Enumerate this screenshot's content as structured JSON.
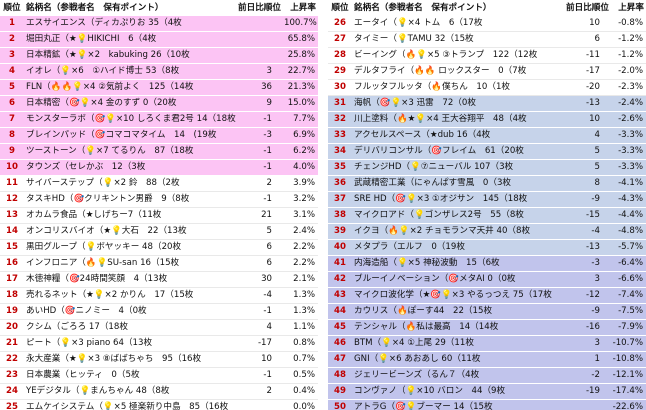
{
  "headers": {
    "rank": "順位",
    "name": "銘柄名（参戦者名　保有ポイント）",
    "change": "前日比順位",
    "rate": "上昇率"
  },
  "left_rows": [
    {
      "rank": "1",
      "name": "エスサイエンス（ディカぷりお 35（4枚",
      "change": "",
      "rate": "100.7%",
      "band": "pink"
    },
    {
      "rank": "2",
      "name": "堀田丸正（★💡HIKICHI　6（4枚",
      "change": "",
      "rate": "65.8%",
      "band": "pink"
    },
    {
      "rank": "3",
      "name": "日本精鉱（★💡×2　kabuking 26（10枚",
      "change": "",
      "rate": "25.8%",
      "band": "pink"
    },
    {
      "rank": "4",
      "name": "イオレ（💡×6　①ハイド博士 53（8枚",
      "change": "3",
      "rate": "22.7%",
      "band": "pink"
    },
    {
      "rank": "5",
      "name": "FLN（🔥🔥💡×4 ②気前よく　125（14枚",
      "change": "36",
      "rate": "21.3%",
      "band": "pink"
    },
    {
      "rank": "6",
      "name": "日本精密（🎯💡×4 金のすず 0（20枚",
      "change": "9",
      "rate": "15.0%",
      "band": "pink"
    },
    {
      "rank": "7",
      "name": "モンスターラボ（🎯💡×10 しろくま君2号 14（18枚",
      "change": "-1",
      "rate": "7.7%",
      "band": "pink"
    },
    {
      "rank": "8",
      "name": "ブレインパッド（🎯コマコマタイム　14　(19枚",
      "change": "-3",
      "rate": "6.9%",
      "band": "pink"
    },
    {
      "rank": "9",
      "name": "ツーストーン（💡×7 てるりん　87（18枚",
      "change": "-1",
      "rate": "6.2%",
      "band": "pink"
    },
    {
      "rank": "10",
      "name": "タウンズ（セレかぶ　12（3枚",
      "change": "-1",
      "rate": "4.0%",
      "band": "pink"
    },
    {
      "rank": "11",
      "name": "サイバーステップ（💡×2 鈴　88（2枚",
      "change": "2",
      "rate": "3.9%",
      "band": "white"
    },
    {
      "rank": "12",
      "name": "タスキHD（🎯クリキントン男爵　9（8枚",
      "change": "-1",
      "rate": "3.2%",
      "band": "white"
    },
    {
      "rank": "13",
      "name": "オカムラ食品（★しげちー7（11枚",
      "change": "21",
      "rate": "3.1%",
      "band": "white"
    },
    {
      "rank": "14",
      "name": "オンコリスバイオ（★💡大石　22（13枚",
      "change": "5",
      "rate": "2.4%",
      "band": "white"
    },
    {
      "rank": "15",
      "name": "黒田グループ（💡ボヤッキー 48（20枚",
      "change": "6",
      "rate": "2.2%",
      "band": "white"
    },
    {
      "rank": "16",
      "name": "インフロニア（🔥💡SU-san 16（15枚",
      "change": "6",
      "rate": "2.2%",
      "band": "white"
    },
    {
      "rank": "17",
      "name": "木徳神糧（🎯24時間笑顔　4（13枚",
      "change": "30",
      "rate": "2.1%",
      "band": "white"
    },
    {
      "rank": "18",
      "name": "売れるネット（★💡×2 かりん　17（15枚",
      "change": "-4",
      "rate": "1.3%",
      "band": "white"
    },
    {
      "rank": "19",
      "name": "あいHD（🎯ニノミー　4（0枚",
      "change": "-1",
      "rate": "1.3%",
      "band": "white"
    },
    {
      "rank": "20",
      "name": "クシム（ごろろ 17（18枚",
      "change": "4",
      "rate": "1.1%",
      "band": "white"
    },
    {
      "rank": "21",
      "name": "ピート（💡×3 piano 64（13枚",
      "change": "-17",
      "rate": "0.8%",
      "band": "white"
    },
    {
      "rank": "22",
      "name": "永大産業（★💡×3 ⑧ばばちゃち　95（16枚",
      "change": "10",
      "rate": "0.7%",
      "band": "white"
    },
    {
      "rank": "23",
      "name": "日本農業（ヒッティ　0（5枚",
      "change": "-1",
      "rate": "0.5%",
      "band": "white"
    },
    {
      "rank": "24",
      "name": "YEデジタル（💡まんちゃん 48（8枚",
      "change": "2",
      "rate": "0.4%",
      "band": "white"
    },
    {
      "rank": "25",
      "name": "エムケイシステム（💡×5 極楽新り中島　85（16枚",
      "change": "",
      "rate": "0.0%",
      "band": "white"
    }
  ],
  "right_rows": [
    {
      "rank": "26",
      "name": "エータイ（💡×4 トム　6（17枚",
      "change": "10",
      "rate": "-0.8%",
      "band": "white"
    },
    {
      "rank": "27",
      "name": "タイミー（💡TAMU 32（15枚",
      "change": "6",
      "rate": "-1.2%",
      "band": "white"
    },
    {
      "rank": "28",
      "name": "ビーイング（🔥💡×5 ③トランプ　122（12枚",
      "change": "-11",
      "rate": "-1.2%",
      "band": "white"
    },
    {
      "rank": "29",
      "name": "デルタフライ（🔥🔥 ロックスター　0（7枚",
      "change": "-17",
      "rate": "-2.0%",
      "band": "white"
    },
    {
      "rank": "30",
      "name": "フルッタフルッタ（🔥僕ちん　10（1枚",
      "change": "-20",
      "rate": "-2.3%",
      "band": "white"
    },
    {
      "rank": "31",
      "name": "海帆（🎯💡×3 迅雷　72（0枚",
      "change": "-13",
      "rate": "-2.4%",
      "band": "blue"
    },
    {
      "rank": "32",
      "name": "川上塗料（🔥★💡×4 王大谷翔平　48（4枚",
      "change": "10",
      "rate": "-2.6%",
      "band": "blue"
    },
    {
      "rank": "33",
      "name": "アクセルスペース（★dub 16（4枚",
      "change": "4",
      "rate": "-3.3%",
      "band": "blue"
    },
    {
      "rank": "34",
      "name": "デリバリコンサル（🎯フレイム　61（20枚",
      "change": "5",
      "rate": "-3.3%",
      "band": "blue"
    },
    {
      "rank": "35",
      "name": "チェンジHD（💡⑦ニューバル 107（3枚",
      "change": "5",
      "rate": "-3.3%",
      "band": "blue"
    },
    {
      "rank": "36",
      "name": "武蔵精密工業（にゃんぱす雪風　0（3枚",
      "change": "8",
      "rate": "-4.1%",
      "band": "blue"
    },
    {
      "rank": "37",
      "name": "SRE HD（🎯💡×3 ①オジサン　145（18枚",
      "change": "-9",
      "rate": "-4.3%",
      "band": "blue"
    },
    {
      "rank": "38",
      "name": "マイクロアド（💡ゴンザレス2号　55（8枚",
      "change": "-15",
      "rate": "-4.4%",
      "band": "blue"
    },
    {
      "rank": "39",
      "name": "イクヨ（🔥💡×2 チョモランマ天井 40（8枚",
      "change": "-4",
      "rate": "-4.8%",
      "band": "blue"
    },
    {
      "rank": "40",
      "name": "メタプラ（エルフ　0（19枚",
      "change": "-13",
      "rate": "-5.7%",
      "band": "blue"
    },
    {
      "rank": "41",
      "name": "内海造船（💡×5 神秘波動　15（6枚",
      "change": "-3",
      "rate": "-6.4%",
      "band": "lav"
    },
    {
      "rank": "42",
      "name": "ブルーイノベーション（🎯メタAI 0（0枚",
      "change": "3",
      "rate": "-6.6%",
      "band": "lav"
    },
    {
      "rank": "43",
      "name": "マイクロ波化学（★🎯💡×3 やるっつえ 75（17枚",
      "change": "-12",
      "rate": "-7.4%",
      "band": "lav"
    },
    {
      "rank": "44",
      "name": "カウリス（🔥ぽーす44　22（15枚",
      "change": "-9",
      "rate": "-7.5%",
      "band": "lav"
    },
    {
      "rank": "45",
      "name": "テンシャル（🔥私は最高　14（14枚",
      "change": "-16",
      "rate": "-7.9%",
      "band": "lav"
    },
    {
      "rank": "46",
      "name": "BTM（💡×4 ①上尾 29（11枚",
      "change": "3",
      "rate": "-10.7%",
      "band": "lav"
    },
    {
      "rank": "47",
      "name": "GNI（💡×6 あおあし 60（11枚",
      "change": "1",
      "rate": "-10.8%",
      "band": "lav"
    },
    {
      "rank": "48",
      "name": "ジェリービーンズ（るん７（4枚",
      "change": "-2",
      "rate": "-12.1%",
      "band": "lav"
    },
    {
      "rank": "49",
      "name": "コンヴァノ（💡×10 バロン　44（9枚",
      "change": "-19",
      "rate": "-17.4%",
      "band": "lav"
    },
    {
      "rank": "50",
      "name": "アトラG（🎯💡ブーマー 14（15枚",
      "change": "",
      "rate": "-22.6%",
      "band": "lav"
    }
  ]
}
